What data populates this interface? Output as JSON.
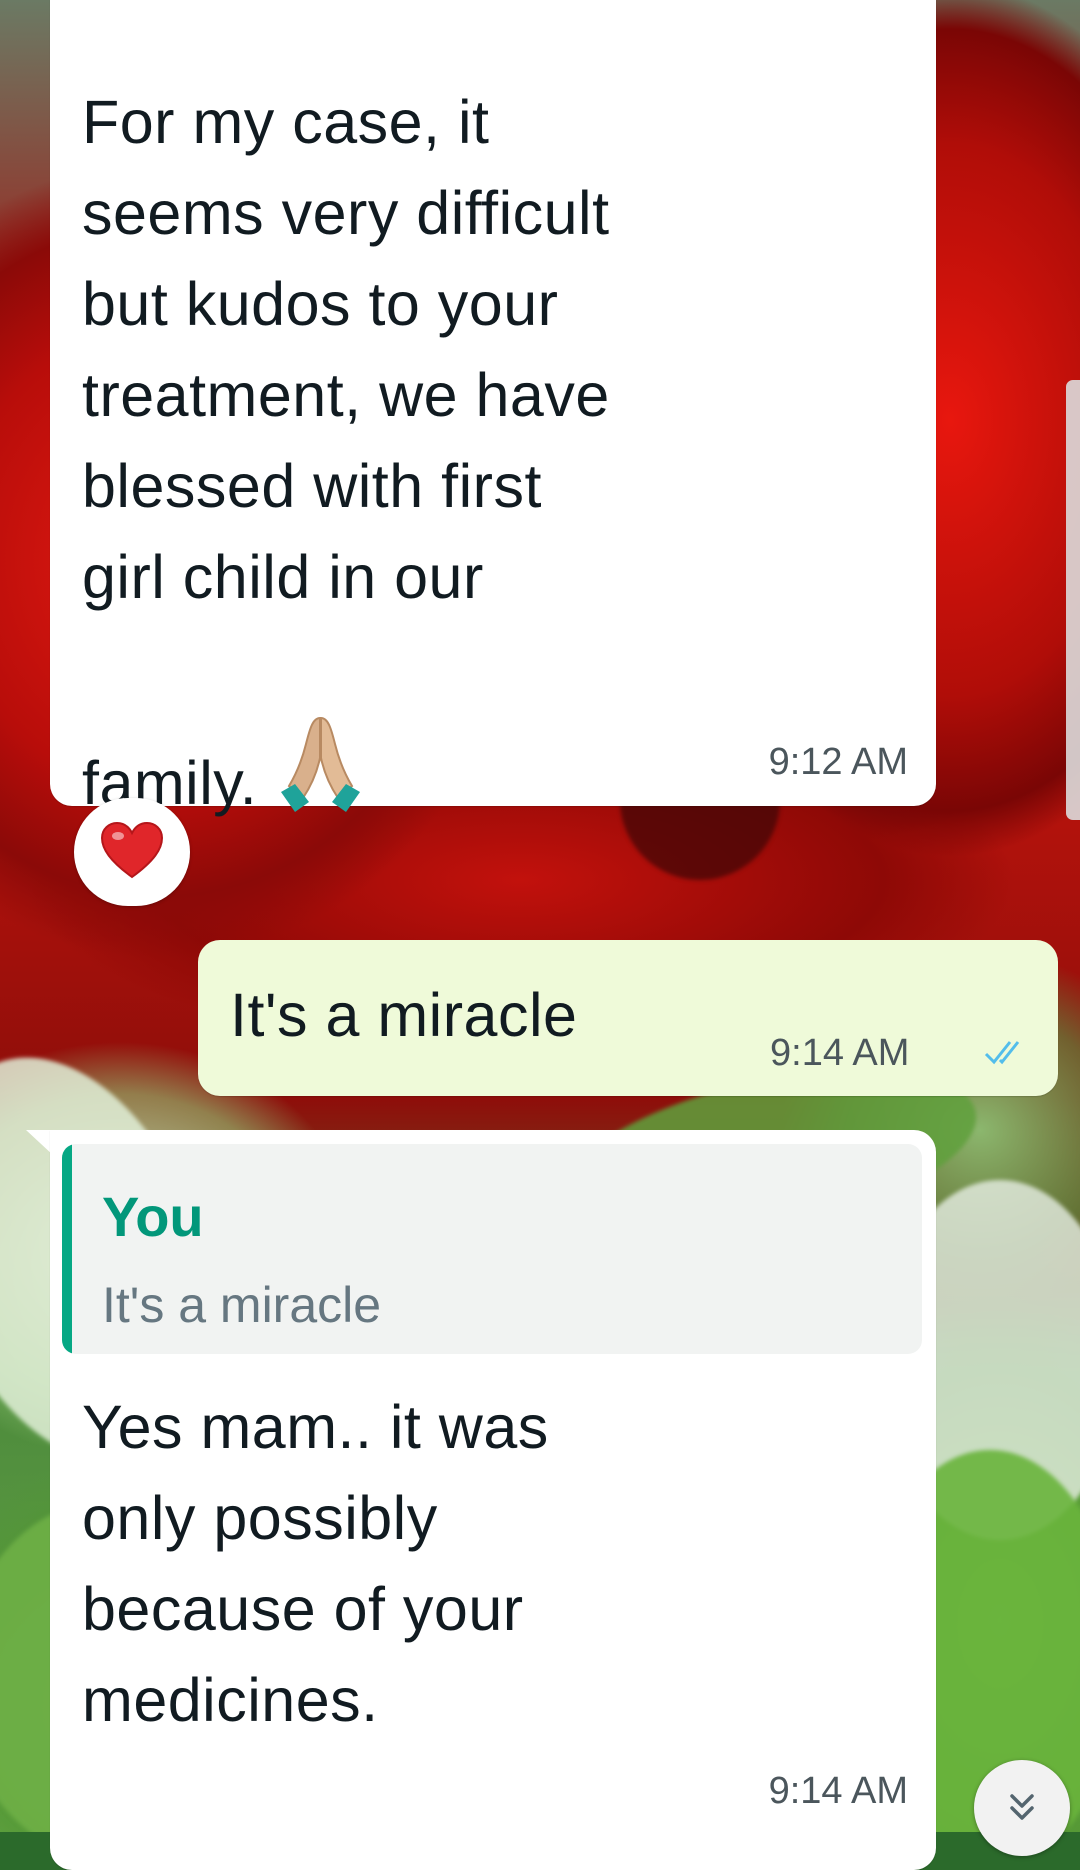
{
  "messages": [
    {
      "direction": "incoming",
      "text": "For my case, it\nseems very difficult\nbut kudos to your\ntreatment, we have\nblessed with first\ngirl child in our\nfamily.",
      "emoji": "folded-hands",
      "time": "9:12 AM",
      "reaction": "red-heart"
    },
    {
      "direction": "outgoing",
      "text": "It's a miracle",
      "time": "9:14 AM",
      "status": "read-double-check"
    },
    {
      "direction": "incoming",
      "quote": {
        "author": "You",
        "text": "It's a miracle"
      },
      "text": "Yes mam.. it was\nonly possibly\nbecause of your\nmedicines.",
      "time": "9:14 AM"
    }
  ],
  "colors": {
    "incoming_bubble": "#ffffff",
    "outgoing_bubble": "#effad9",
    "quote_accent": "#06a884",
    "read_tick": "#53bdeb"
  },
  "icons": {
    "scroll_down": "double-chevron-down-icon"
  }
}
